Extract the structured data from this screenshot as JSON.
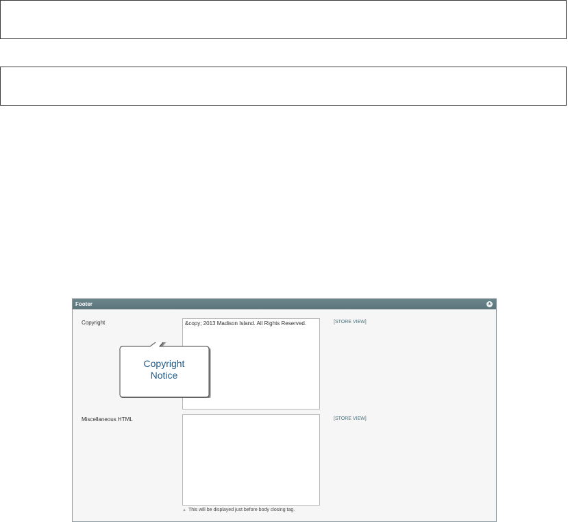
{
  "panel": {
    "title": "Footer",
    "collapse_icon": "chevron-up-icon"
  },
  "fields": {
    "copyright": {
      "label": "Copyright",
      "value": "&copy; 2013 Madison Island. All Rights Reserved.",
      "scope": "[STORE VIEW]"
    },
    "misc_html": {
      "label": "Miscellaneous HTML",
      "value": "",
      "scope": "[STORE VIEW]",
      "note": "This will be displayed just before body closing tag."
    }
  },
  "callout": {
    "line1": "Copyright",
    "line2": "Notice"
  },
  "colors": {
    "header": "#5f7980",
    "scope_link": "#4a6d78",
    "callout_text": "#1f5a8a"
  }
}
